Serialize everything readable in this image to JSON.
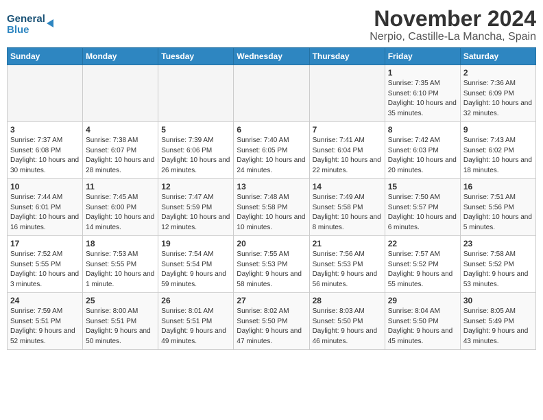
{
  "header": {
    "logo_general": "General",
    "logo_blue": "Blue",
    "title": "November 2024",
    "subtitle": "Nerpio, Castille-La Mancha, Spain"
  },
  "weekdays": [
    "Sunday",
    "Monday",
    "Tuesday",
    "Wednesday",
    "Thursday",
    "Friday",
    "Saturday"
  ],
  "weeks": [
    [
      {
        "day": "",
        "info": ""
      },
      {
        "day": "",
        "info": ""
      },
      {
        "day": "",
        "info": ""
      },
      {
        "day": "",
        "info": ""
      },
      {
        "day": "",
        "info": ""
      },
      {
        "day": "1",
        "info": "Sunrise: 7:35 AM\nSunset: 6:10 PM\nDaylight: 10 hours and 35 minutes."
      },
      {
        "day": "2",
        "info": "Sunrise: 7:36 AM\nSunset: 6:09 PM\nDaylight: 10 hours and 32 minutes."
      }
    ],
    [
      {
        "day": "3",
        "info": "Sunrise: 7:37 AM\nSunset: 6:08 PM\nDaylight: 10 hours and 30 minutes."
      },
      {
        "day": "4",
        "info": "Sunrise: 7:38 AM\nSunset: 6:07 PM\nDaylight: 10 hours and 28 minutes."
      },
      {
        "day": "5",
        "info": "Sunrise: 7:39 AM\nSunset: 6:06 PM\nDaylight: 10 hours and 26 minutes."
      },
      {
        "day": "6",
        "info": "Sunrise: 7:40 AM\nSunset: 6:05 PM\nDaylight: 10 hours and 24 minutes."
      },
      {
        "day": "7",
        "info": "Sunrise: 7:41 AM\nSunset: 6:04 PM\nDaylight: 10 hours and 22 minutes."
      },
      {
        "day": "8",
        "info": "Sunrise: 7:42 AM\nSunset: 6:03 PM\nDaylight: 10 hours and 20 minutes."
      },
      {
        "day": "9",
        "info": "Sunrise: 7:43 AM\nSunset: 6:02 PM\nDaylight: 10 hours and 18 minutes."
      }
    ],
    [
      {
        "day": "10",
        "info": "Sunrise: 7:44 AM\nSunset: 6:01 PM\nDaylight: 10 hours and 16 minutes."
      },
      {
        "day": "11",
        "info": "Sunrise: 7:45 AM\nSunset: 6:00 PM\nDaylight: 10 hours and 14 minutes."
      },
      {
        "day": "12",
        "info": "Sunrise: 7:47 AM\nSunset: 5:59 PM\nDaylight: 10 hours and 12 minutes."
      },
      {
        "day": "13",
        "info": "Sunrise: 7:48 AM\nSunset: 5:58 PM\nDaylight: 10 hours and 10 minutes."
      },
      {
        "day": "14",
        "info": "Sunrise: 7:49 AM\nSunset: 5:58 PM\nDaylight: 10 hours and 8 minutes."
      },
      {
        "day": "15",
        "info": "Sunrise: 7:50 AM\nSunset: 5:57 PM\nDaylight: 10 hours and 6 minutes."
      },
      {
        "day": "16",
        "info": "Sunrise: 7:51 AM\nSunset: 5:56 PM\nDaylight: 10 hours and 5 minutes."
      }
    ],
    [
      {
        "day": "17",
        "info": "Sunrise: 7:52 AM\nSunset: 5:55 PM\nDaylight: 10 hours and 3 minutes."
      },
      {
        "day": "18",
        "info": "Sunrise: 7:53 AM\nSunset: 5:55 PM\nDaylight: 10 hours and 1 minute."
      },
      {
        "day": "19",
        "info": "Sunrise: 7:54 AM\nSunset: 5:54 PM\nDaylight: 9 hours and 59 minutes."
      },
      {
        "day": "20",
        "info": "Sunrise: 7:55 AM\nSunset: 5:53 PM\nDaylight: 9 hours and 58 minutes."
      },
      {
        "day": "21",
        "info": "Sunrise: 7:56 AM\nSunset: 5:53 PM\nDaylight: 9 hours and 56 minutes."
      },
      {
        "day": "22",
        "info": "Sunrise: 7:57 AM\nSunset: 5:52 PM\nDaylight: 9 hours and 55 minutes."
      },
      {
        "day": "23",
        "info": "Sunrise: 7:58 AM\nSunset: 5:52 PM\nDaylight: 9 hours and 53 minutes."
      }
    ],
    [
      {
        "day": "24",
        "info": "Sunrise: 7:59 AM\nSunset: 5:51 PM\nDaylight: 9 hours and 52 minutes."
      },
      {
        "day": "25",
        "info": "Sunrise: 8:00 AM\nSunset: 5:51 PM\nDaylight: 9 hours and 50 minutes."
      },
      {
        "day": "26",
        "info": "Sunrise: 8:01 AM\nSunset: 5:51 PM\nDaylight: 9 hours and 49 minutes."
      },
      {
        "day": "27",
        "info": "Sunrise: 8:02 AM\nSunset: 5:50 PM\nDaylight: 9 hours and 47 minutes."
      },
      {
        "day": "28",
        "info": "Sunrise: 8:03 AM\nSunset: 5:50 PM\nDaylight: 9 hours and 46 minutes."
      },
      {
        "day": "29",
        "info": "Sunrise: 8:04 AM\nSunset: 5:50 PM\nDaylight: 9 hours and 45 minutes."
      },
      {
        "day": "30",
        "info": "Sunrise: 8:05 AM\nSunset: 5:49 PM\nDaylight: 9 hours and 43 minutes."
      }
    ]
  ]
}
